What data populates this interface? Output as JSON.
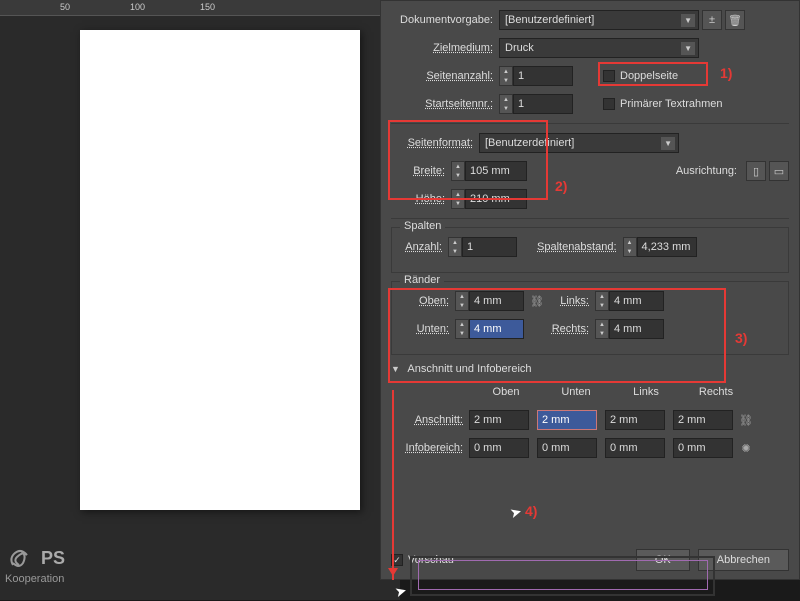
{
  "ruler": {
    "m1": "50",
    "m2": "100",
    "m3": "150"
  },
  "doc": {
    "preset_label": "Dokumentvorgabe:",
    "preset_value": "[Benutzerdefiniert]",
    "intent_label": "Zielmedium:",
    "intent_value": "Druck",
    "pages_label": "Seitenanzahl:",
    "pages_value": "1",
    "facing_label": "Doppelseite",
    "startpage_label": "Startseitennr.:",
    "startpage_value": "1",
    "primary_tf_label": "Primärer Textrahmen"
  },
  "pagesize": {
    "label": "Seitenformat:",
    "value": "[Benutzerdefiniert]",
    "width_label": "Breite:",
    "width_value": "105 mm",
    "height_label": "Höhe:",
    "height_value": "210 mm",
    "orient_label": "Ausrichtung:"
  },
  "columns": {
    "title": "Spalten",
    "count_label": "Anzahl:",
    "count_value": "1",
    "gutter_label": "Spaltenabstand:",
    "gutter_value": "4,233 mm"
  },
  "margins": {
    "title": "Ränder",
    "top_label": "Oben:",
    "top_value": "4 mm",
    "bottom_label": "Unten:",
    "bottom_value": "4 mm",
    "left_label": "Links:",
    "left_value": "4 mm",
    "right_label": "Rechts:",
    "right_value": "4 mm"
  },
  "bleed": {
    "title": "Anschnitt und Infobereich",
    "col_top": "Oben",
    "col_bottom": "Unten",
    "col_left": "Links",
    "col_right": "Rechts",
    "bleed_label": "Anschnitt:",
    "bleed_top": "2 mm",
    "bleed_bottom": "2 mm",
    "bleed_left": "2 mm",
    "bleed_right": "2 mm",
    "slug_label": "Infobereich:",
    "slug_top": "0 mm",
    "slug_bottom": "0 mm",
    "slug_left": "0 mm",
    "slug_right": "0 mm"
  },
  "footer": {
    "preview": "Vorschau",
    "ok": "OK",
    "cancel": "Abbrechen"
  },
  "anno": {
    "a1": "1)",
    "a2": "2)",
    "a3": "3)",
    "a4": "4)"
  },
  "logo": {
    "text": "PS",
    "sub": "Kooperation"
  }
}
